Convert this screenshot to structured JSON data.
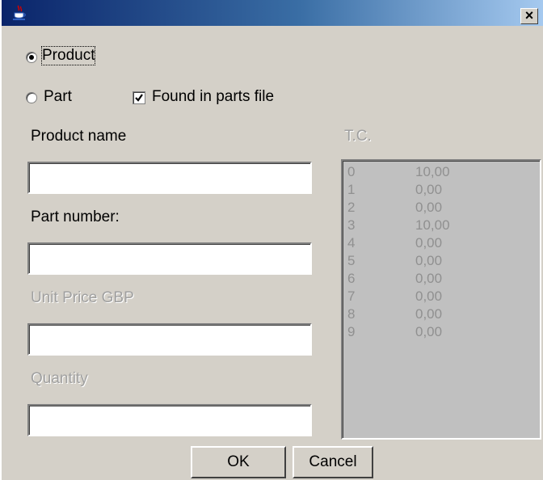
{
  "titlebar": {
    "title": "",
    "app_icon": "java-cup-icon",
    "close_label": "×",
    "colors": {
      "start": "#0a246a",
      "end": "#a6caf0"
    }
  },
  "options": {
    "product_label": "Product",
    "part_label": "Part",
    "product_selected": true,
    "found_label": "Found in parts file",
    "found_checked": true
  },
  "fields": {
    "product_name_label": "Product name",
    "product_name_value": "",
    "part_number_label": "Part number:",
    "part_number_value": "",
    "unit_price_label": "Unit Price GBP",
    "unit_price_value": "",
    "quantity_label": "Quantity",
    "quantity_value": ""
  },
  "tc": {
    "label": "T.C.",
    "rows": [
      {
        "index": "0",
        "value": "10,00"
      },
      {
        "index": "1",
        "value": "0,00"
      },
      {
        "index": "2",
        "value": "0,00"
      },
      {
        "index": "3",
        "value": "10,00"
      },
      {
        "index": "4",
        "value": "0,00"
      },
      {
        "index": "5",
        "value": "0,00"
      },
      {
        "index": "6",
        "value": "0,00"
      },
      {
        "index": "7",
        "value": "0,00"
      },
      {
        "index": "8",
        "value": "0,00"
      },
      {
        "index": "9",
        "value": "0,00"
      }
    ]
  },
  "buttons": {
    "ok_label": "OK",
    "cancel_label": "Cancel"
  }
}
